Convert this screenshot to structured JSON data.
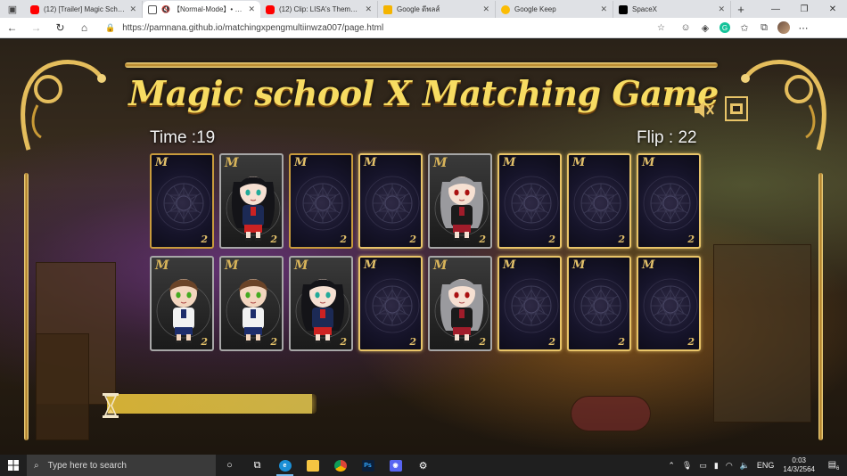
{
  "browser": {
    "tabs": [
      {
        "title": "(12) [Trailer] Magic School",
        "favicon": "youtube-icon",
        "active": false
      },
      {
        "title": "【Normal-Mode】• Magic",
        "favicon": "page-icon",
        "active": true,
        "muted": true
      },
      {
        "title": "(12) Clip: LISA's Theme Song",
        "favicon": "youtube-icon",
        "active": false
      },
      {
        "title": "Google ดีพลส์",
        "favicon": "note-icon",
        "active": false
      },
      {
        "title": "Google Keep",
        "favicon": "keep-icon",
        "active": false
      },
      {
        "title": "SpaceX",
        "favicon": "spacex-icon",
        "active": false
      }
    ],
    "url": "https://pamnana.github.io/matchingxpengmultiinwza007/page.html"
  },
  "game": {
    "title": "Magic school X Matching Game",
    "time_label": "Time :19",
    "flip_label": "Flip : 22",
    "progress_fraction": 0.98,
    "cards": [
      {
        "row": 0,
        "col": 0,
        "state": "back"
      },
      {
        "row": 0,
        "col": 1,
        "state": "face",
        "character": "dark-haired-girl"
      },
      {
        "row": 0,
        "col": 2,
        "state": "back"
      },
      {
        "row": 0,
        "col": 3,
        "state": "back",
        "highlight": true
      },
      {
        "row": 0,
        "col": 4,
        "state": "face",
        "character": "grey-haired-girl"
      },
      {
        "row": 0,
        "col": 5,
        "state": "back",
        "highlight": true
      },
      {
        "row": 0,
        "col": 6,
        "state": "back",
        "highlight": true
      },
      {
        "row": 0,
        "col": 7,
        "state": "back",
        "highlight": true
      },
      {
        "row": 1,
        "col": 0,
        "state": "face",
        "character": "brown-haired-boy"
      },
      {
        "row": 1,
        "col": 1,
        "state": "face",
        "character": "brown-haired-boy"
      },
      {
        "row": 1,
        "col": 2,
        "state": "face",
        "character": "dark-haired-girl"
      },
      {
        "row": 1,
        "col": 3,
        "state": "back",
        "highlight": true
      },
      {
        "row": 1,
        "col": 4,
        "state": "face",
        "character": "grey-haired-girl"
      },
      {
        "row": 1,
        "col": 5,
        "state": "back",
        "highlight": true
      },
      {
        "row": 1,
        "col": 6,
        "state": "back",
        "highlight": true
      },
      {
        "row": 1,
        "col": 7,
        "state": "back",
        "highlight": true
      }
    ],
    "card_mark": "M",
    "card_corner": "2",
    "colors": {
      "gold": "#c89b3c",
      "title": "#f7dc62",
      "card_back": "#16142a"
    }
  },
  "taskbar": {
    "search_placeholder": "Type here to search",
    "apps": [
      "task-view-icon",
      "edge-icon",
      "file-explorer-icon",
      "chrome-icon",
      "photoshop-icon",
      "discord-icon",
      "settings-icon"
    ],
    "language": "ENG",
    "time": "0:03",
    "date": "14/3/2564",
    "notifications": "6"
  }
}
